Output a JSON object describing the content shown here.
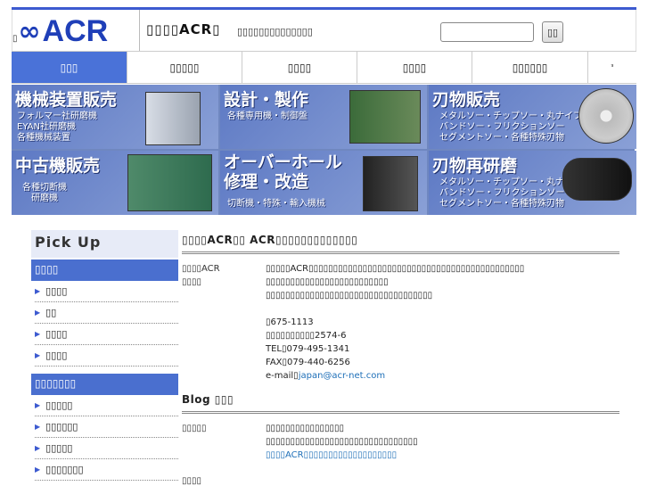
{
  "header": {
    "logo_prefix": "▯",
    "logo_symbol": "∞",
    "logo_text": "ACR",
    "site_title": "▯▯▯▯ACR▯",
    "site_subtitle": "▯▯▯▯▯▯▯▯▯▯▯▯▯▯",
    "search_placeholder": "",
    "search_button": "▯▯"
  },
  "nav": {
    "items": [
      {
        "label": "▯▯▯"
      },
      {
        "label": "▯▯▯▯▯"
      },
      {
        "label": "▯▯▯▯"
      },
      {
        "label": "▯▯▯▯"
      },
      {
        "label": "▯▯▯▯▯▯"
      },
      {
        "label": "ᵌ"
      }
    ]
  },
  "banner": {
    "tiles": [
      {
        "title": "機械装置販売",
        "sub": "フォルマー社研磨機\nEYAN社研磨機\n各種機械装置"
      },
      {
        "title": "設計・製作",
        "sub": "各種専用機・制御盤"
      },
      {
        "title": "刃物販売",
        "sub": "メタルソー・チップソー・丸ナイフ\nバンドソー・フリクションソー\nセグメントソー・各種特殊刃物"
      },
      {
        "title": "中古機販売",
        "sub": "各種切断機\n　研磨機"
      },
      {
        "title": "オーバーホール\n修理・改造",
        "sub": "切断機・特殊・輸入機械"
      },
      {
        "title": "刃物再研磨",
        "sub": "メタルソー・チップソー・丸ナイフ\nバンドソー・フリクションソー\nセグメントソー・各種特殊刃物"
      }
    ]
  },
  "sidebar": {
    "pickup_title": "Pick Up",
    "sections": [
      {
        "heading": "▯▯▯▯",
        "links": [
          "▯▯▯▯",
          "▯▯",
          "▯▯▯▯",
          "▯▯▯▯"
        ]
      },
      {
        "heading": "▯▯▯▯▯▯▯",
        "links": [
          "▯▯▯▯▯",
          "▯▯▯▯▯▯",
          "▯▯▯▯▯",
          "▯▯▯▯▯▯▯"
        ]
      }
    ]
  },
  "main": {
    "company_heading": "▯▯▯▯ACR▯▯ ACR▯▯▯▯▯▯▯▯▯▯▯▯▯",
    "company_label": "▯▯▯▯ACR\n▯▯▯▯",
    "company_line1": "▯▯▯▯▯ACR▯▯▯▯▯▯▯▯▯▯▯▯▯▯▯▯▯▯▯▯▯▯▯▯▯▯▯▯▯▯▯▯▯▯▯▯▯▯▯▯▯▯▯▯",
    "company_line2": "▯▯▯▯▯▯▯▯▯▯▯▯▯▯▯▯▯▯▯▯▯▯▯▯▯",
    "company_line3": "▯▯▯▯▯▯▯▯▯▯▯▯▯▯▯▯▯▯▯▯▯▯▯▯▯▯▯▯▯▯▯▯▯▯",
    "postal": "▯675-1113",
    "address": "▯▯▯▯▯▯▯▯▯▯2574-6",
    "tel": "TEL▯079-495-1341",
    "fax": "FAX▯079-440-6256",
    "email_label": "e-mail▯",
    "email": "japan@acr-net.com",
    "blog_heading": "Blog ▯▯▯",
    "blog_label": "▯▯▯▯▯",
    "blog_line1": "▯▯▯▯▯▯▯▯▯▯▯▯▯▯▯▯",
    "blog_line2": "▯▯▯▯▯▯▯▯▯▯▯▯▯▯▯▯▯▯▯▯▯▯▯▯▯▯▯▯▯▯▯",
    "blog_link": "▯▯▯▯ACR▯▯▯▯▯▯▯▯▯▯▯▯▯▯▯▯▯▯▯",
    "next_label": "▯▯▯▯"
  },
  "colors": {
    "accent": "#3c5ad0",
    "nav_active": "#4a72d8",
    "logo": "#1f3fb8",
    "link": "#1e6fb8"
  }
}
